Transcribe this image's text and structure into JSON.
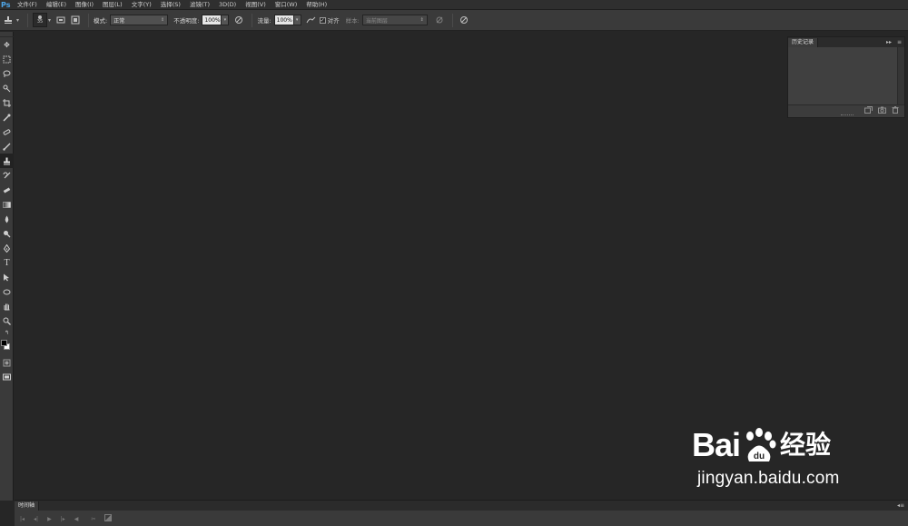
{
  "app": {
    "logo": "Ps"
  },
  "menu": [
    "文件(F)",
    "编辑(E)",
    "图像(I)",
    "图层(L)",
    "文字(Y)",
    "选择(S)",
    "滤镜(T)",
    "3D(D)",
    "视图(V)",
    "窗口(W)",
    "帮助(H)"
  ],
  "options_bar": {
    "brush_size": "35",
    "mode_label": "模式:",
    "mode_value": "正常",
    "opacity_label": "不透明度:",
    "opacity_value": "100%",
    "flow_label": "流量:",
    "flow_value": "100%",
    "aligned_label": "对齐",
    "aligned_checked": true,
    "sample_label": "样本:",
    "sample_value": "当前图层"
  },
  "toolbar": {
    "active_tool": "clone-stamp-tool",
    "foreground_color": "#000000",
    "background_color": "#ffffff"
  },
  "history_panel": {
    "tab": "历史记录"
  },
  "timeline_panel": {
    "tab": "时间轴"
  },
  "watermark": {
    "brand_left": "Bai",
    "brand_right": "经验",
    "url": "jingyan.baidu.com"
  },
  "colors": {
    "workspace": "#262626",
    "panel": "#3a3a3a",
    "accent": "#4ea6e8"
  }
}
